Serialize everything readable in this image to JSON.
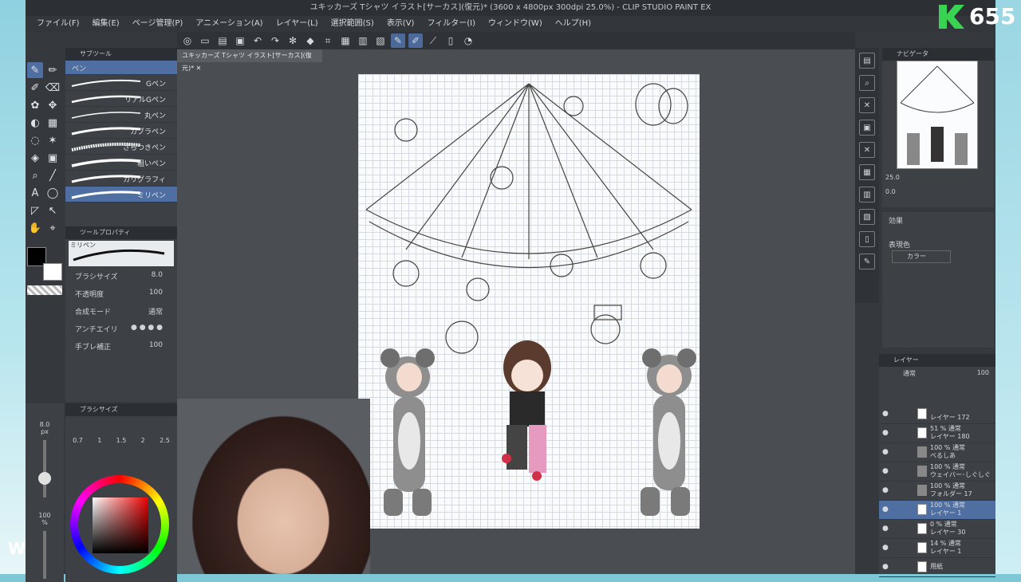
{
  "window": {
    "title": "ユキッカーズ Tシャツ イラスト[サーカス](復元)* (3600 x 4800px 300dpi 25.0%) - CLIP STUDIO PAINT EX"
  },
  "menu": [
    "ファイル(F)",
    "編集(E)",
    "ページ管理(P)",
    "アニメーション(A)",
    "レイヤー(L)",
    "選択範囲(S)",
    "表示(V)",
    "フィルター(I)",
    "ウィンドウ(W)",
    "ヘルプ(H)"
  ],
  "doc_tab": "ユキッカーズ Tシャツ イラスト[サーカス](復元)*",
  "subtool": {
    "title": "サブツール",
    "group": "ペン",
    "items": [
      "Gペン",
      "リアルGペン",
      "丸ペン",
      "カブラペン",
      "ざらつきペン",
      "粗いペン",
      "カリグラフィ",
      "ミリペン"
    ]
  },
  "toolprop": {
    "title": "ツールプロパティ",
    "brush_name": "ミリペン",
    "rows": [
      {
        "k": "ブラシサイズ",
        "v": "8.0"
      },
      {
        "k": "不透明度",
        "v": "100"
      },
      {
        "k": "合成モード",
        "v": "通常"
      },
      {
        "k": "アンチエイリ",
        "v": ""
      },
      {
        "k": "手ブレ補正",
        "v": "100"
      }
    ]
  },
  "brushsize": {
    "title": "ブラシサイズ",
    "values": [
      "0.7",
      "1",
      "1.5",
      "2",
      "2.5"
    ],
    "current": "8.0",
    "unit": "px",
    "opacity": "100",
    "opacity_unit": "%"
  },
  "navigator": {
    "title": "ナビゲータ",
    "zoom": "25.0",
    "rot": "0.0"
  },
  "effect": {
    "label": "効果",
    "color_label": "表現色",
    "color_value": "カラー"
  },
  "layer": {
    "title": "レイヤー",
    "blend": "通常",
    "opacity": "100",
    "rows": [
      {
        "pct": "",
        "name": "レイヤー 172"
      },
      {
        "pct": "51 % 通常",
        "name": "レイヤー 180"
      },
      {
        "pct": "100 % 通常",
        "name": "べるしあ"
      },
      {
        "pct": "100 % 通常",
        "name": "ウェイバー･しぐしぐ"
      },
      {
        "pct": "100 % 通常",
        "name": "フォルダー 17"
      },
      {
        "pct": "100 % 通常",
        "name": "レイヤー 1"
      },
      {
        "pct": "0 % 通常",
        "name": "レイヤー 30"
      },
      {
        "pct": "14 % 通常",
        "name": "レイヤー 1"
      },
      {
        "pct": "",
        "name": "用紙"
      }
    ]
  },
  "overlay": {
    "k_count": "655",
    "corner_letter": "W"
  }
}
